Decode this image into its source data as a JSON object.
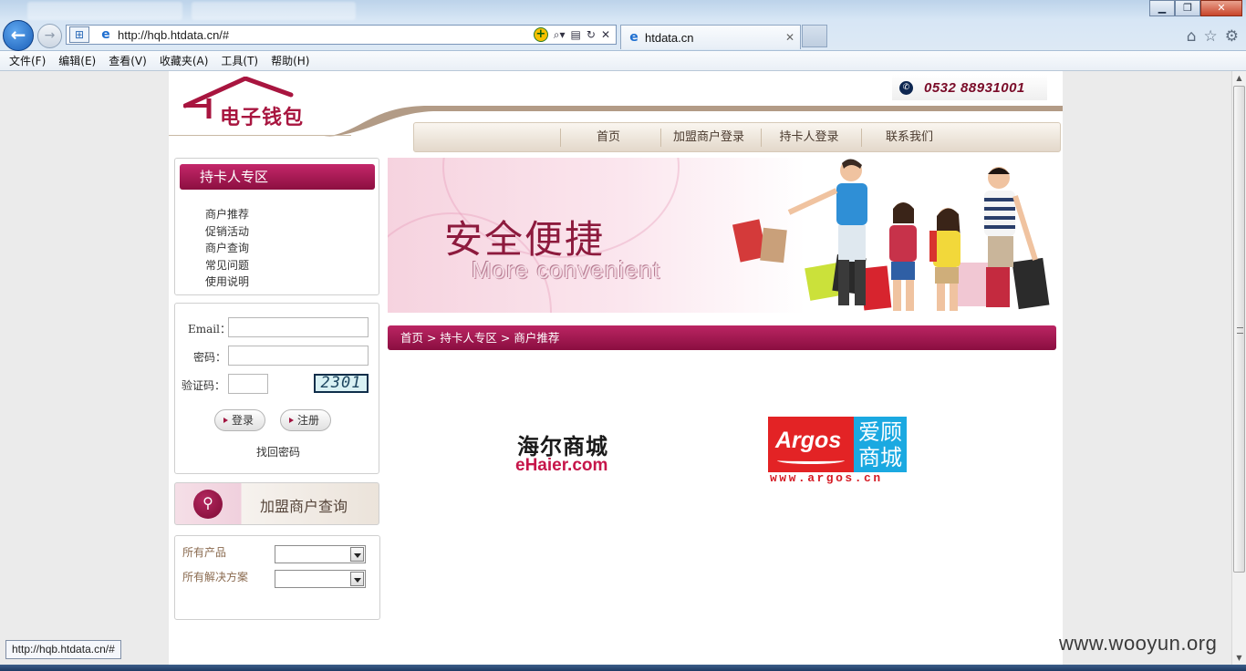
{
  "browser": {
    "address_url": "http://hqb.htdata.cn/#",
    "tab_title": "htdata.cn",
    "status_url": "http://hqb.htdata.cn/#",
    "menu": [
      "文件(F)",
      "编辑(E)",
      "查看(V)",
      "收藏夹(A)",
      "工具(T)",
      "帮助(H)"
    ]
  },
  "header": {
    "logo_text": "电子钱包",
    "phone": "0532  88931001",
    "nav": [
      "首页",
      "加盟商户登录",
      "持卡人登录",
      "联系我们"
    ]
  },
  "sidebar": {
    "zone_title": "持卡人专区",
    "links": [
      "商户推荐",
      "促销活动",
      "商户查询",
      "常见问题",
      "使用说明"
    ],
    "login": {
      "email_label": "Email：",
      "password_label": "密码：",
      "captcha_label": "验证码：",
      "captcha_value": "2301",
      "login_button": "登录",
      "register_button": "注册",
      "forgot_link": "找回密码"
    },
    "merchant_query_label": "加盟商户查询",
    "filters": {
      "products_label": "所有产品",
      "solutions_label": "所有解决方案"
    }
  },
  "banner": {
    "slogan": "安全便捷",
    "slogan_en": "More convenient"
  },
  "breadcrumb": "首页 > 持卡人专区 > 商户推荐",
  "merchants": {
    "ehaier_cn": "海尔商城",
    "ehaier_en": "eHaier.com",
    "argos_word": "Argos",
    "argos_cn_line1": "爱顾",
    "argos_cn_line2": "商城",
    "argos_url": "www.argos.cn"
  },
  "watermark": "www.wooyun.org",
  "colors": {
    "brand": "#a8153f",
    "brand_gradient_top": "#bb2563",
    "nav_beige": "#e3d8ca",
    "argos_red": "#e32325",
    "argos_blue": "#1ba9e1"
  }
}
